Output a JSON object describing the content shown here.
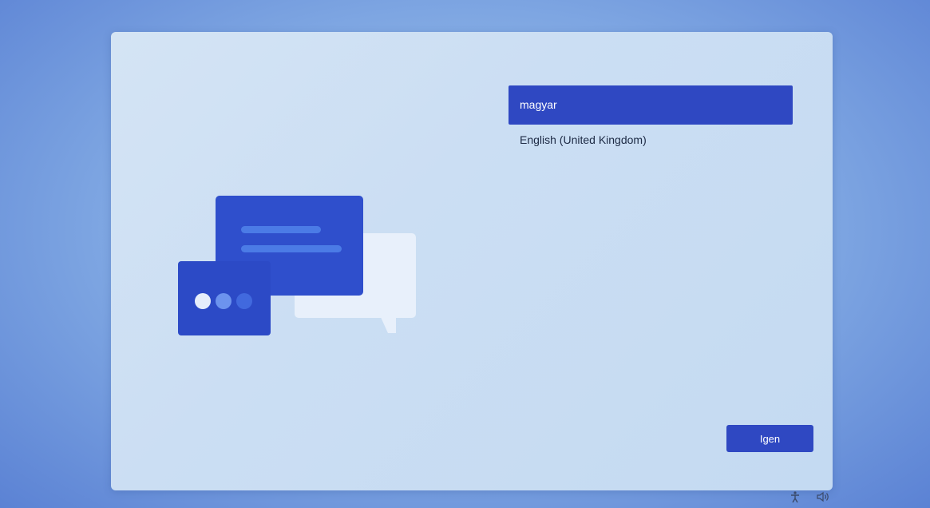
{
  "languages": [
    {
      "label": "magyar",
      "selected": true
    },
    {
      "label": "English (United Kingdom)",
      "selected": false
    }
  ],
  "buttons": {
    "yes_label": "Igen"
  },
  "tray": {
    "accessibility_icon": "accessibility-icon",
    "volume_icon": "volume-icon"
  },
  "colors": {
    "accent": "#2f48c2",
    "panel": "#cbdef3",
    "background": "#7ea6e2"
  }
}
